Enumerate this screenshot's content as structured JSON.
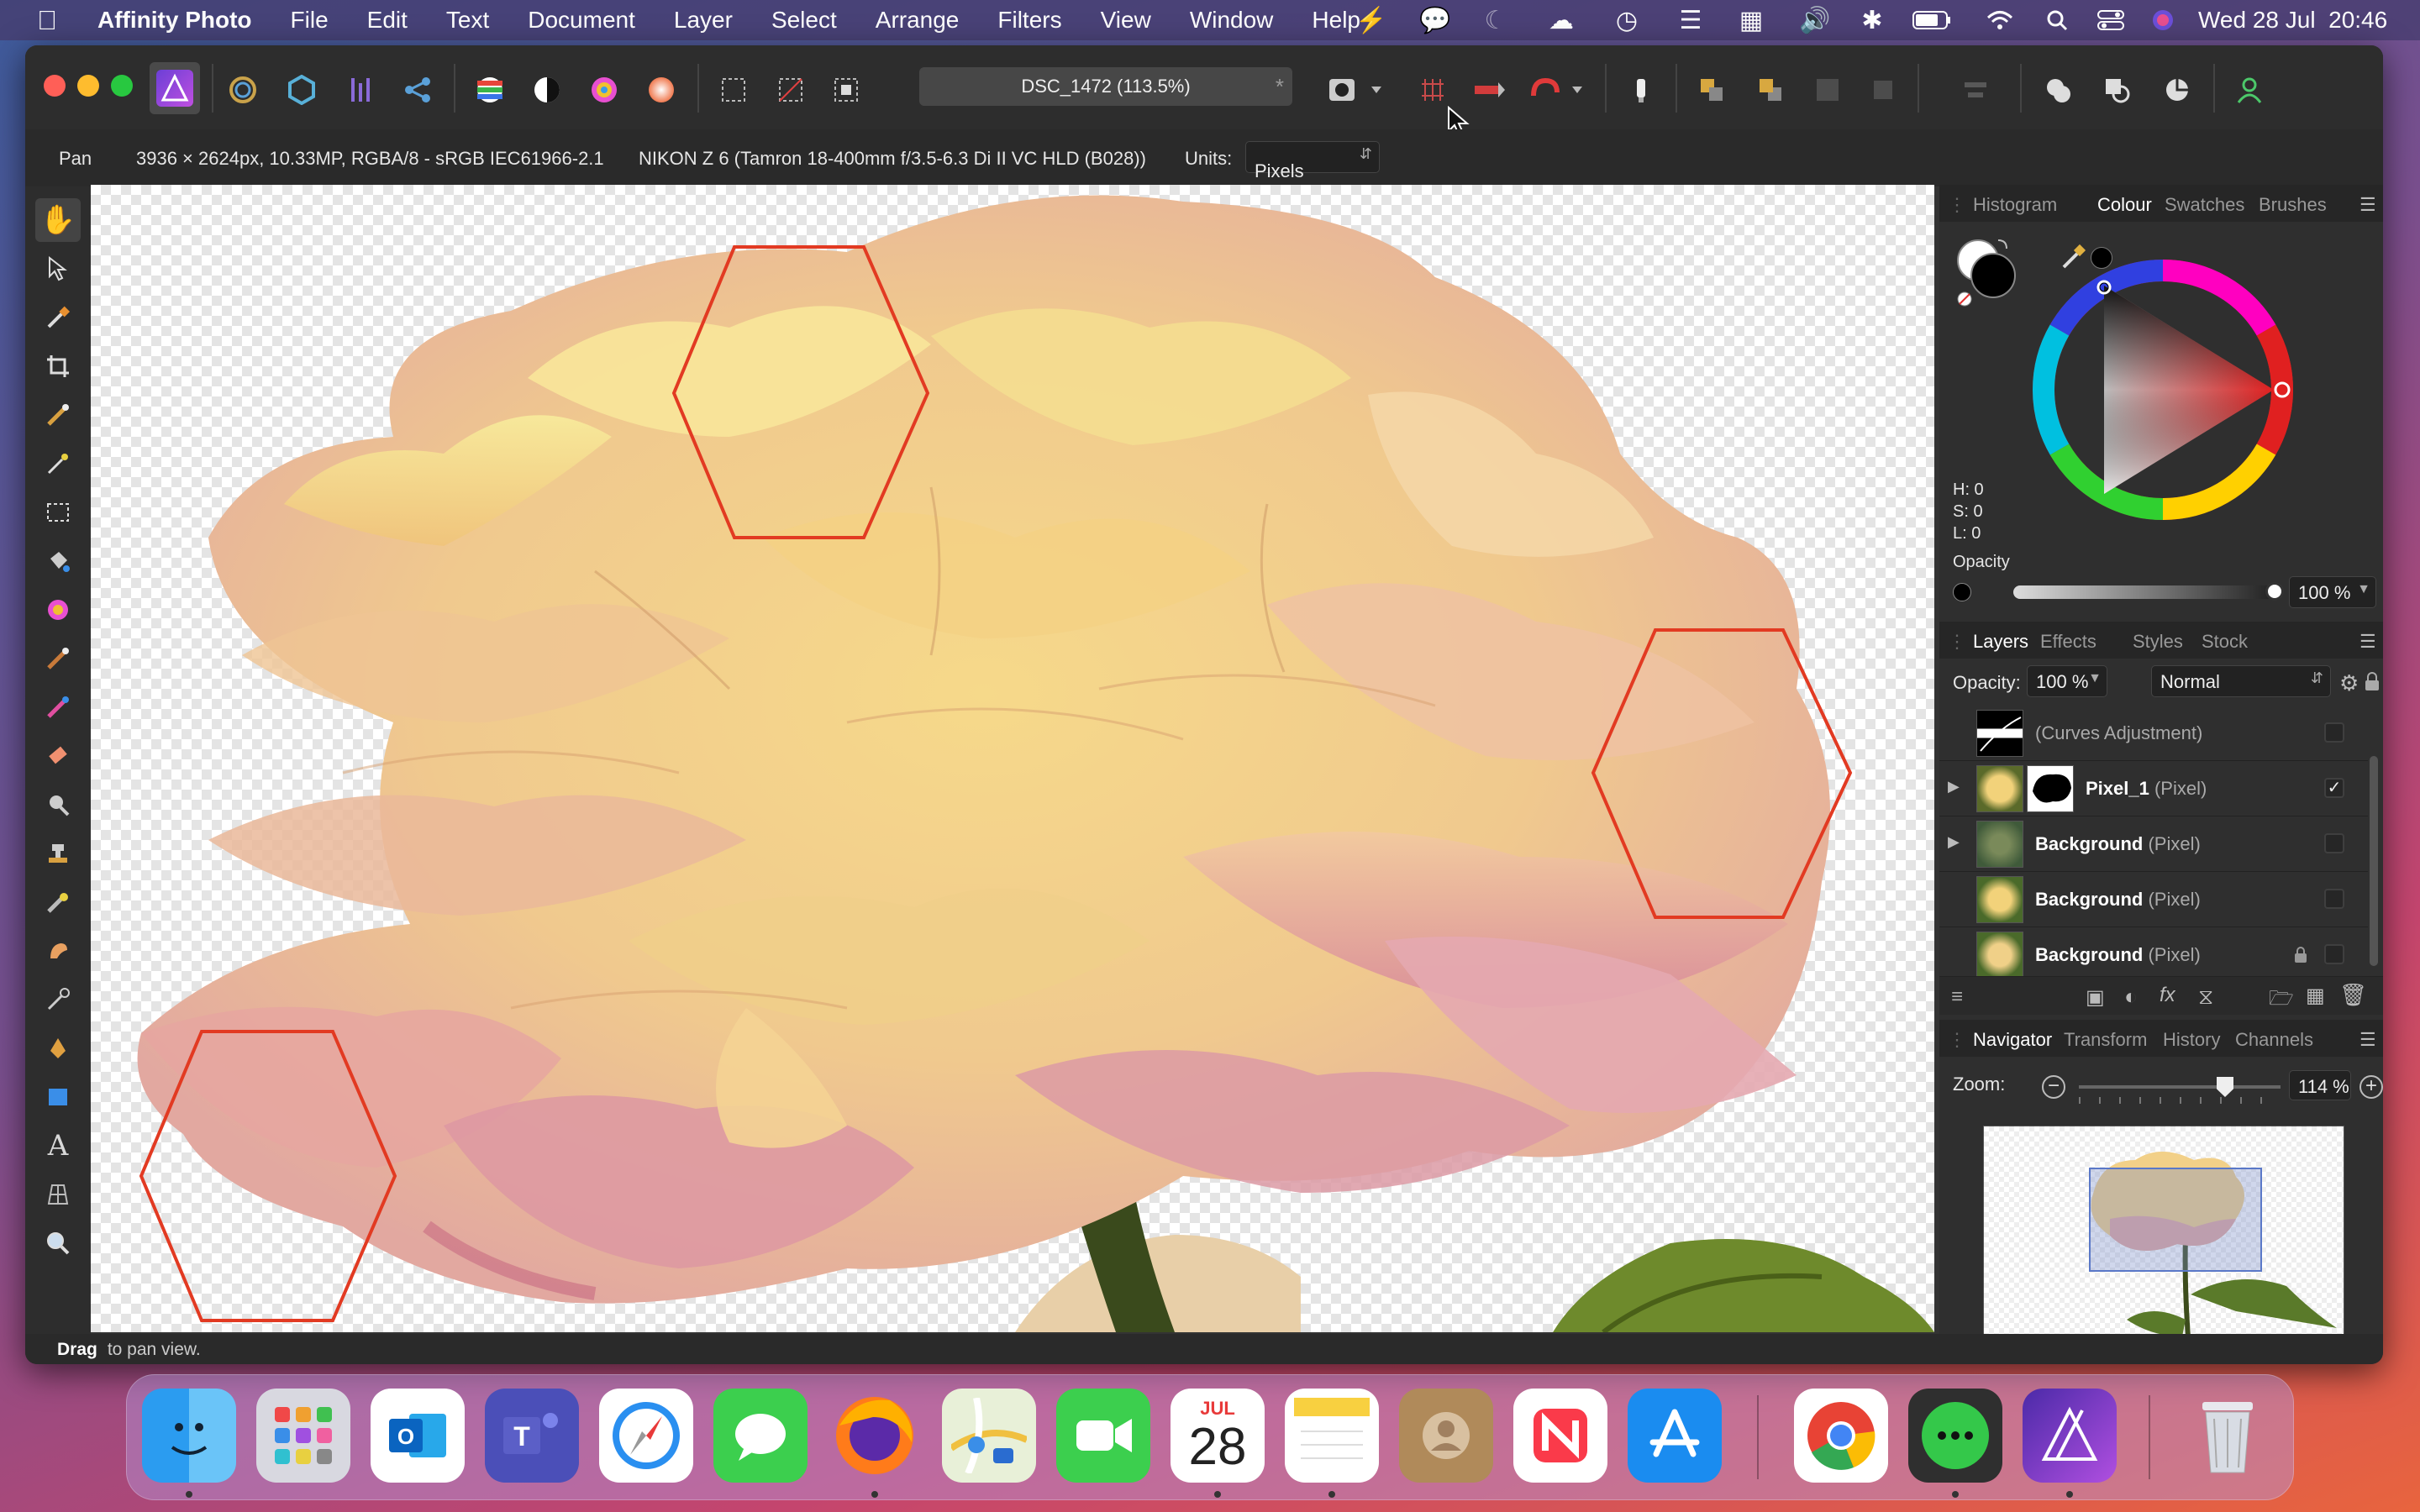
{
  "menubar": {
    "app_name": "Affinity Photo",
    "items": [
      "File",
      "Edit",
      "Text",
      "Document",
      "Layer",
      "Select",
      "Arrange",
      "Filters",
      "View",
      "Window",
      "Help"
    ],
    "datetime": "Wed 28 Jul  20:46"
  },
  "document": {
    "title": "DSC_1472 (113.5%)",
    "close_glyph": "*"
  },
  "context_bar": {
    "tool_name": "Pan",
    "image_info": "3936 × 2624px, 10.33MP, RGBA/8 - sRGB IEC61966-2.1",
    "camera_info": "NIKON Z 6 (Tamron 18-400mm f/3.5-6.3 Di II VC HLD (B028))",
    "units_label": "Units:",
    "units_value": "Pixels"
  },
  "colour_panel": {
    "tabs": [
      "Histogram",
      "Colour",
      "Swatches",
      "Brushes"
    ],
    "active_tab": "Colour",
    "h": "H: 0",
    "s": "S: 0",
    "l": "L: 0",
    "opacity_label": "Opacity",
    "opacity_value": "100 %",
    "opacity_fraction": 1.0
  },
  "layers_panel": {
    "tabs": [
      "Layers",
      "Effects",
      "Styles",
      "Stock"
    ],
    "active_tab": "Layers",
    "opacity_label": "Opacity:",
    "opacity_value": "100 %",
    "blend_mode": "Normal",
    "layers": [
      {
        "name": "",
        "type": "(Curves Adjustment)",
        "visible": false,
        "locked": false,
        "expandable": false
      },
      {
        "name": "Pixel_1",
        "type": "(Pixel)",
        "visible": true,
        "locked": false,
        "expandable": true
      },
      {
        "name": "Background",
        "type": "(Pixel)",
        "visible": false,
        "locked": false,
        "expandable": true
      },
      {
        "name": "Background",
        "type": "(Pixel)",
        "visible": false,
        "locked": false,
        "expandable": false
      },
      {
        "name": "Background",
        "type": "(Pixel)",
        "visible": false,
        "locked": true,
        "expandable": false
      }
    ]
  },
  "navigator_panel": {
    "tabs": [
      "Navigator",
      "Transform",
      "History",
      "Channels"
    ],
    "active_tab": "Navigator",
    "zoom_label": "Zoom:",
    "zoom_value": "114 %"
  },
  "status_bar": {
    "bold": "Drag",
    "text": " to pan view."
  },
  "dock": {
    "calendar_month": "JUL",
    "calendar_day": "28",
    "apps": [
      "Finder",
      "Launchpad",
      "Outlook",
      "Teams",
      "Safari",
      "Messages",
      "Firefox",
      "Maps",
      "FaceTime",
      "Calendar",
      "Notes",
      "Contacts",
      "News",
      "App Store",
      "Chrome",
      "Chat",
      "Affinity Photo",
      "Trash"
    ]
  },
  "colors": {
    "accent": "#3b82f6",
    "hexagon_stroke": "#e23a22",
    "canvas_checker": "#e4e4e4"
  }
}
